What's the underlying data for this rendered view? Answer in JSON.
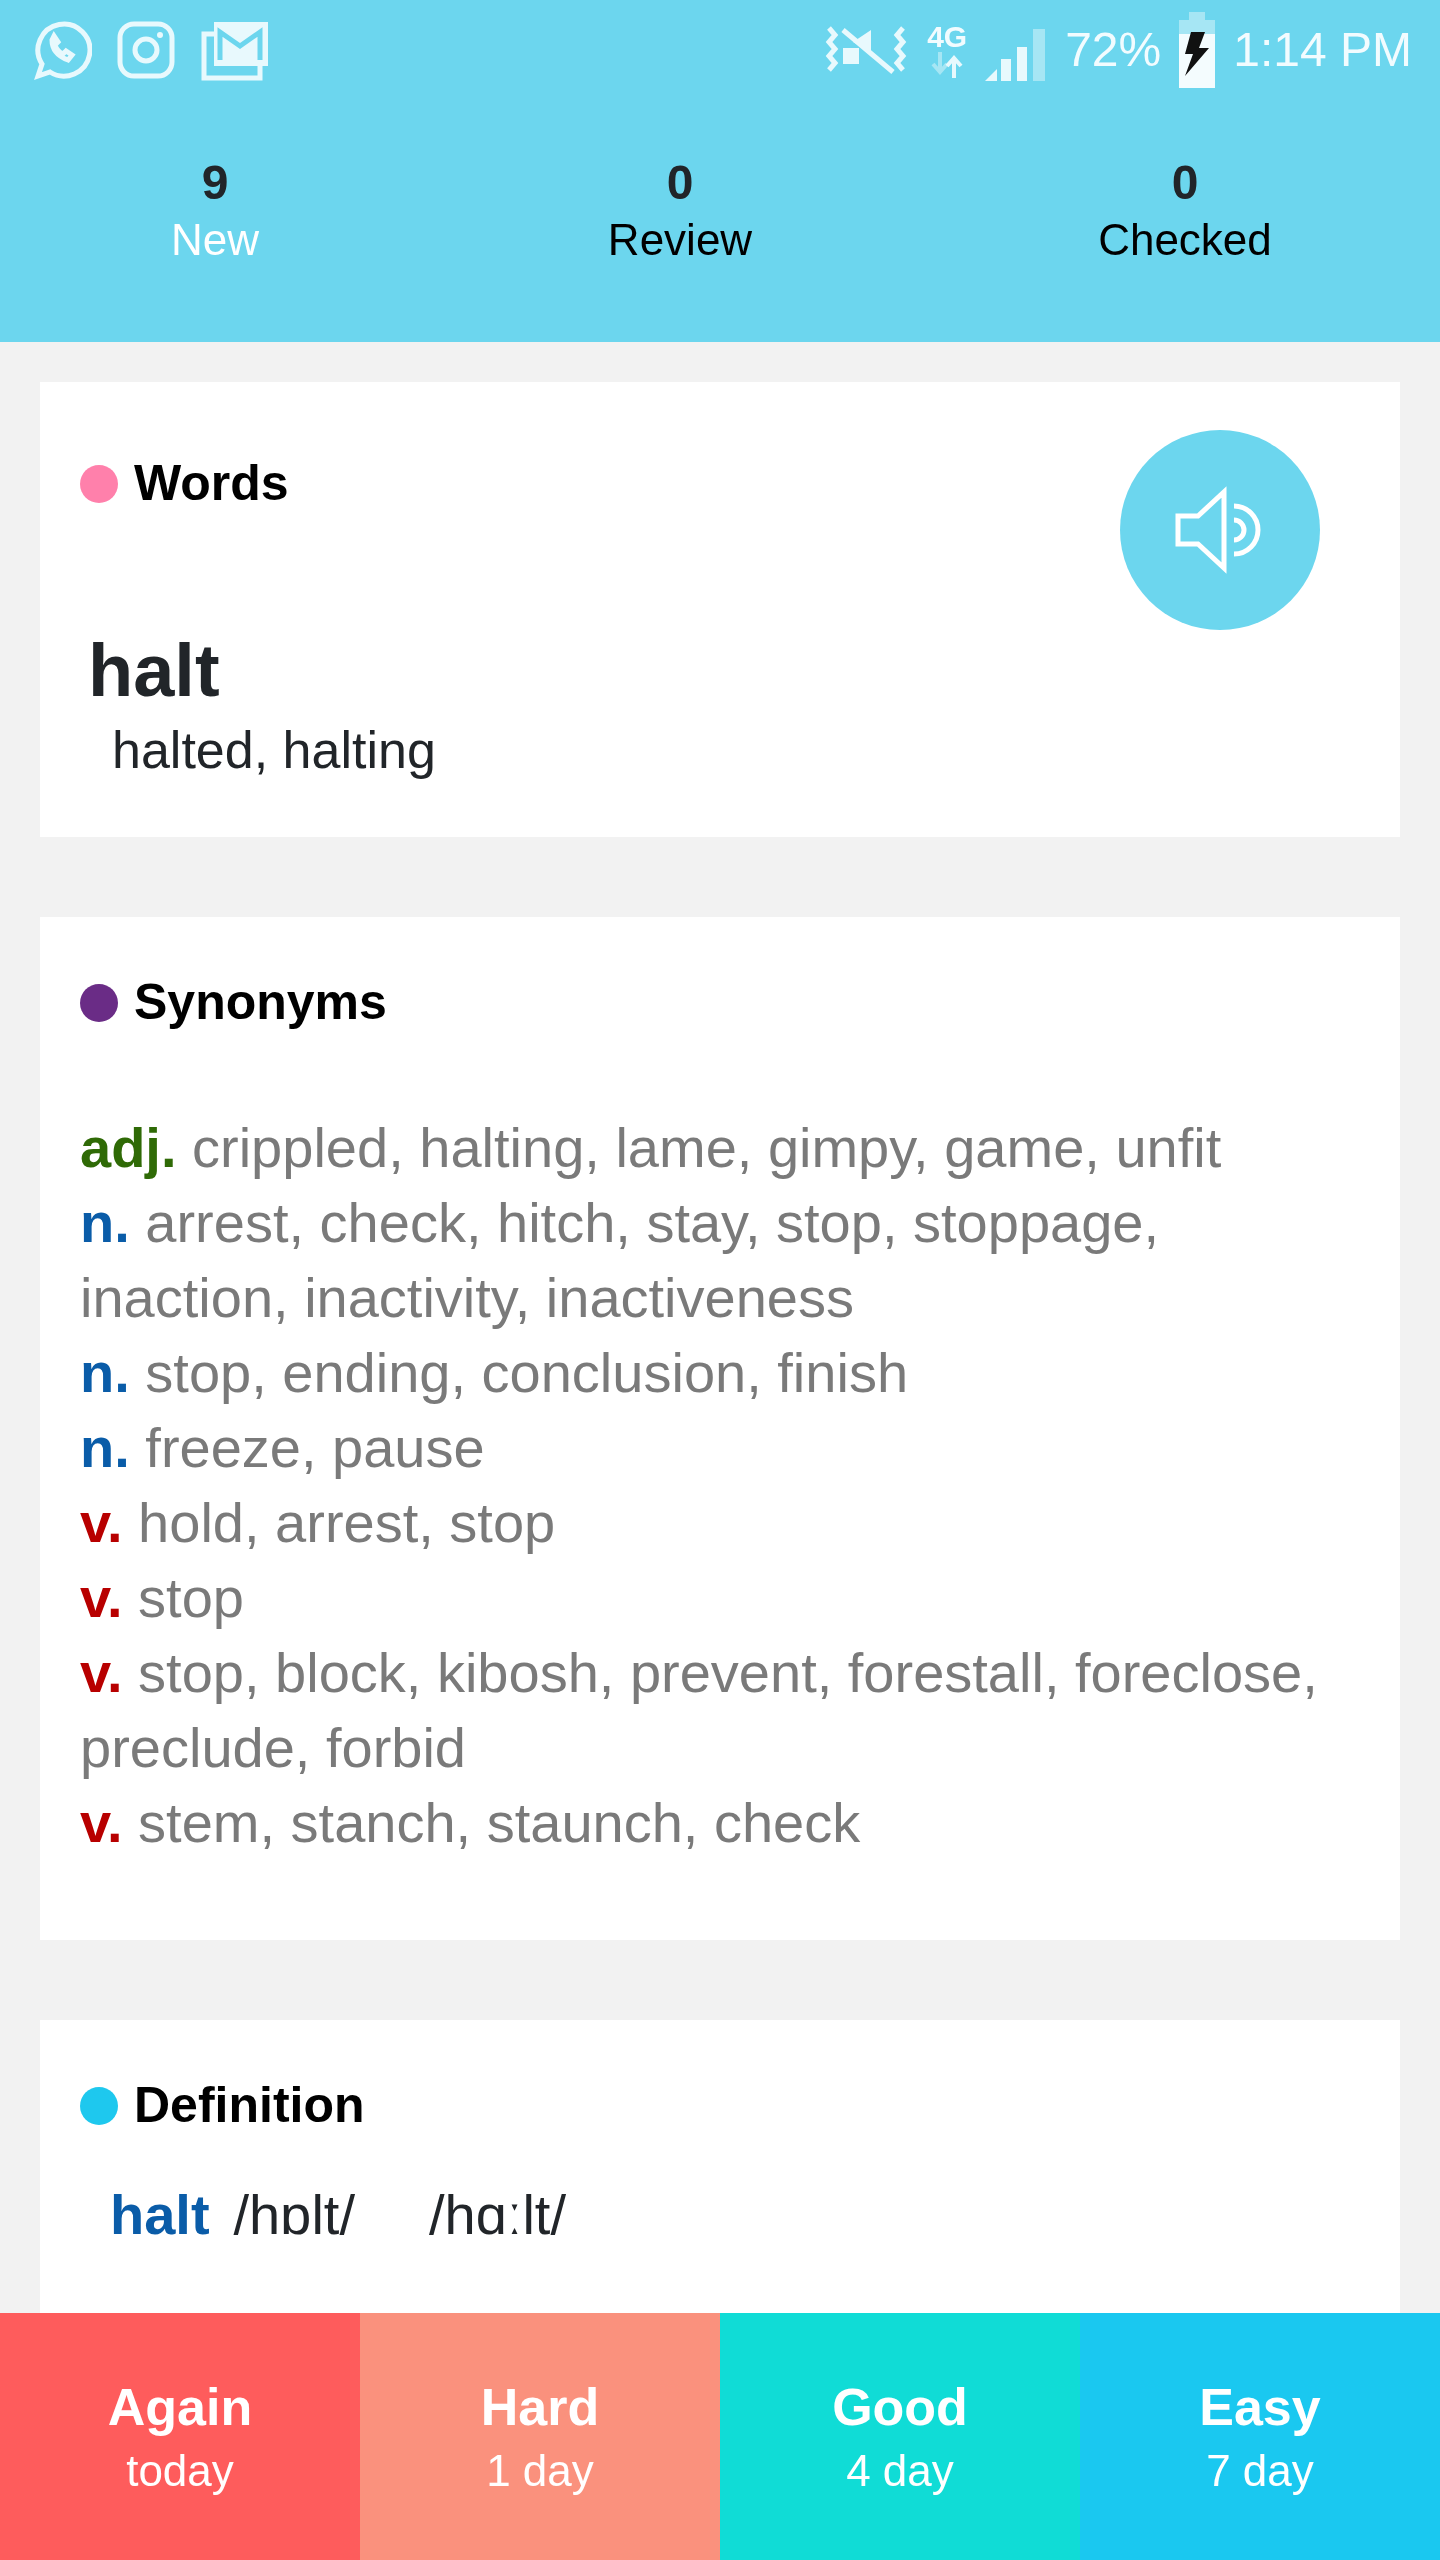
{
  "status_bar": {
    "network": "4G",
    "battery": "72%",
    "time": "1:14 PM"
  },
  "stats": [
    {
      "count": "9",
      "label": "New",
      "selected": true
    },
    {
      "count": "0",
      "label": "Review",
      "selected": false
    },
    {
      "count": "0",
      "label": "Checked",
      "selected": false
    }
  ],
  "word_card": {
    "title": "Words",
    "color": "#ff80ab",
    "word": "halt",
    "forms": "halted, halting"
  },
  "synonyms_card": {
    "title": "Synonyms",
    "color": "#6a2c86",
    "entries": [
      {
        "kind": "adj",
        "pos": "adj.",
        "words": "crippled, halting, lame, gimpy, game, unfit"
      },
      {
        "kind": "noun",
        "pos": "n.",
        "words": "arrest, check, hitch, stay, stop, stoppage, inaction, inactivity, inactiveness"
      },
      {
        "kind": "noun",
        "pos": "n.",
        "words": "stop, ending, conclusion, finish"
      },
      {
        "kind": "noun",
        "pos": "n.",
        "words": "freeze, pause"
      },
      {
        "kind": "verb",
        "pos": "v.",
        "words": "hold, arrest, stop"
      },
      {
        "kind": "verb",
        "pos": "v.",
        "words": "stop"
      },
      {
        "kind": "verb",
        "pos": "v.",
        "words": "stop, block, kibosh, prevent, forestall, foreclose, preclude, forbid"
      },
      {
        "kind": "verb",
        "pos": "v.",
        "words": "stem, stanch, staunch, check"
      }
    ]
  },
  "definition_card": {
    "title": "Definition",
    "color": "#1ec8ee",
    "headword": "halt",
    "pron_uk": "/hɒlt/",
    "pron_us": "/hɑːlt/"
  },
  "answer_buttons": [
    {
      "label": "Again",
      "interval": "today",
      "color": "#fe5c5c"
    },
    {
      "label": "Hard",
      "interval": "1 day",
      "color": "#fa917d"
    },
    {
      "label": "Good",
      "interval": "4 day",
      "color": "#10dcd6"
    },
    {
      "label": "Easy",
      "interval": "7 day",
      "color": "#1ac8f0"
    }
  ]
}
